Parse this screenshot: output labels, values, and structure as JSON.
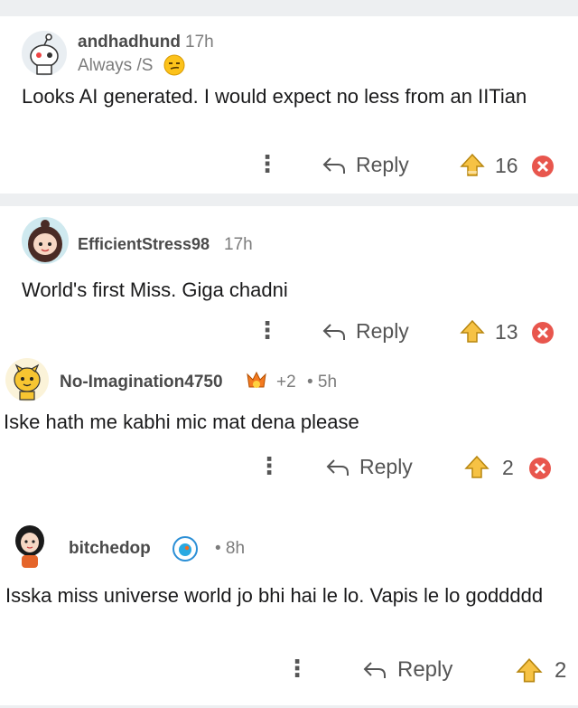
{
  "comments": [
    {
      "username": "andhadhund",
      "time": "17h",
      "flair": "Always /S",
      "body": "Looks AI generated. I would expect no less from an IITian",
      "reply_label": "Reply",
      "votes": "16",
      "avatar": "reddit-snoo-avatar"
    },
    {
      "username": "EfficientStress98",
      "time": "17h",
      "body": "World's first Miss. Giga chadni",
      "reply_label": "Reply",
      "votes": "13",
      "avatar": "girl-avatar"
    },
    {
      "username": "No-Imagination4750",
      "extra": "+2",
      "time": "• 5h",
      "body": "Iske hath me kabhi mic mat dena please",
      "reply_label": "Reply",
      "votes": "2",
      "avatar": "tiger-avatar"
    },
    {
      "username": "bitchedop",
      "time": "• 8h",
      "body": "Isska miss universe world jo bhi hai le lo. Vapis le lo goddddd",
      "reply_label": "Reply",
      "votes": "2",
      "avatar": "woman-avatar"
    }
  ],
  "colors": {
    "separator": "#edeff1",
    "text": "#1a1a1b",
    "meta": "#7c7c7c",
    "upvote": "#f6c244",
    "downvote": "#e8564d"
  }
}
